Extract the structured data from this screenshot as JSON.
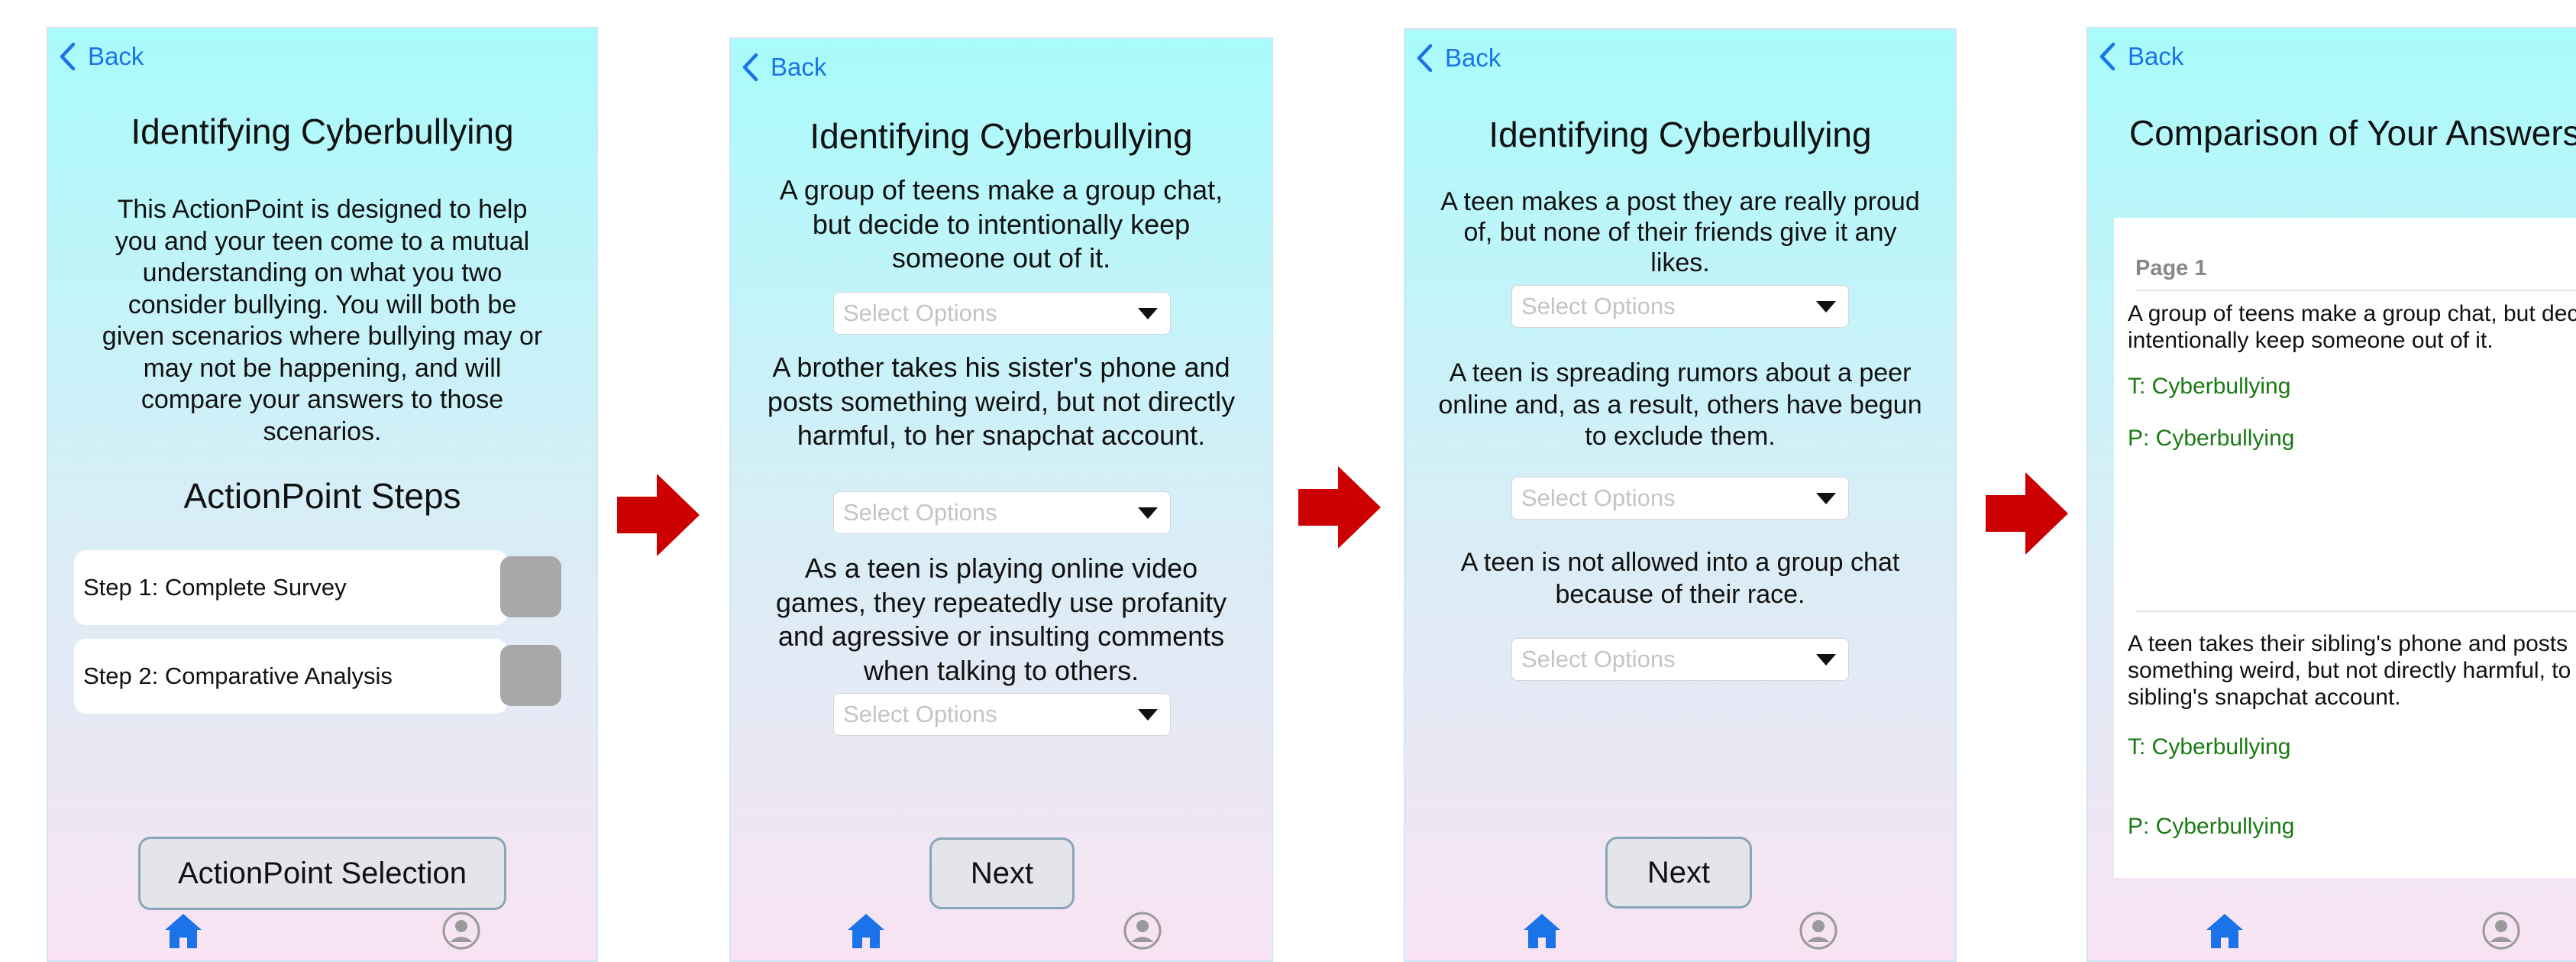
{
  "back_label": "Back",
  "screen1": {
    "title": "Identifying Cyberbullying",
    "description": "This ActionPoint is designed to help you and your teen come to a mutual understanding on what you two consider bullying. You will both be given scenarios where bullying may or may not be happening, and will compare your answers to those scenarios.",
    "steps_title": "ActionPoint Steps",
    "steps": [
      "Step 1: Complete Survey",
      "Step 2: Comparative Analysis"
    ],
    "button": "ActionPoint Selection"
  },
  "screen2": {
    "title": "Identifying Cyberbullying",
    "questions": [
      "A group of teens make a group chat, but decide to intentionally keep someone out of it.",
      "A brother takes his sister's phone and posts something weird, but not directly harmful, to her snapchat account.",
      "As a teen is playing online video games, they repeatedly use profanity and agressive or insulting comments when talking to others."
    ],
    "select_placeholder": "Select Options",
    "button": "Next"
  },
  "screen3": {
    "title": "Identifying Cyberbullying",
    "questions": [
      "A teen makes a post they are really proud of, but none of their friends give it any likes.",
      "A teen is spreading rumors about a peer online and, as a result, others have begun to exclude them.",
      "A teen is not allowed into a group chat because of their race."
    ],
    "select_placeholder": "Select Options",
    "button": "Next"
  },
  "screen4": {
    "title": "Comparison of Your Answers",
    "page_label": "Page 1",
    "items": [
      {
        "question": "A group of teens make a group chat, but decide to intentionally keep someone out of it.",
        "teen": "T: Cyberbullying",
        "parent": "P: Cyberbullying"
      },
      {
        "question": "A teen takes their sibling's phone and posts something weird, but not directly harmful, to their sibling's snapchat account.",
        "teen": "T: Cyberbullying",
        "parent": "P: Cyberbullying"
      }
    ]
  },
  "colors": {
    "accent": "#1a73e8",
    "arrow": "#cc0000",
    "answer": "#1b7a14",
    "nav_inactive": "#9a9a9a"
  },
  "icons": {
    "back": "chevron-left-icon",
    "home": "home-icon",
    "profile": "profile-icon",
    "flow": "arrow-right-icon"
  }
}
